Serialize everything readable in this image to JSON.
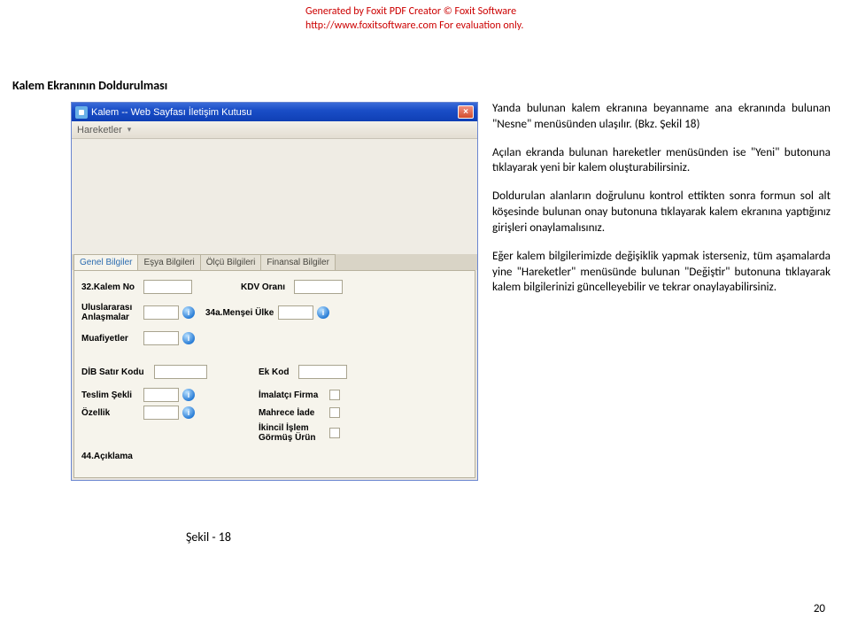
{
  "watermark": {
    "line1_a": "Generated by Foxit PDF Creator ",
    "line1_b": "© Foxit Software",
    "line2_a": "http://www.foxitsoftware.com",
    "line2_b": "   For evaluation only."
  },
  "heading": "Kalem Ekranının Doldurulması",
  "dialog": {
    "title": "Kalem -- Web Sayfası İletişim Kutusu",
    "menu": "Hareketler",
    "tabs": [
      "Genel Bilgiler",
      "Eşya Bilgileri",
      "Ölçü Bilgileri",
      "Finansal Bilgiler"
    ],
    "labels": {
      "kalem_no": "32.Kalem No",
      "kdv_orani": "KDV Oranı",
      "uluslararasi": "Uluslararası Anlaşmalar",
      "mensei": "34a.Menşei Ülke",
      "muafiyetler": "Muafiyetler",
      "dib": "DİB Satır Kodu",
      "ekkod": "Ek Kod",
      "teslim": "Teslim Şekli",
      "ozellik": "Özellik",
      "imalatci": "İmalatçı Firma",
      "mahrece": "Mahrece İade",
      "ikincil": "İkincil İşlem Görmüş Ürün",
      "aciklama": "44.Açıklama"
    }
  },
  "paragraphs": {
    "p1": "Yanda bulunan kalem ekranına beyanname ana ekranında bulunan \"Nesne\" menüsünden ulaşılır. (Bkz. Şekil 18)",
    "p2": "Açılan ekranda bulunan hareketler menüsünden ise \"Yeni\" butonuna tıklayarak yeni bir kalem oluşturabilirsiniz.",
    "p3": "Doldurulan alanların doğrulunu kontrol ettikten sonra formun sol alt köşesinde bulunan onay butonuna tıklayarak kalem ekranına yaptığınız girişleri onaylamalısınız.",
    "p4": "Eğer kalem bilgilerimizde değişiklik yapmak isterseniz, tüm aşamalarda yine \"Hareketler\" menüsünde bulunan \"Değiştir\" butonuna tıklayarak kalem bilgilerinizi güncelleyebilir ve tekrar onaylayabilirsiniz."
  },
  "figure_caption": "Şekil - 18",
  "page_num": "20"
}
